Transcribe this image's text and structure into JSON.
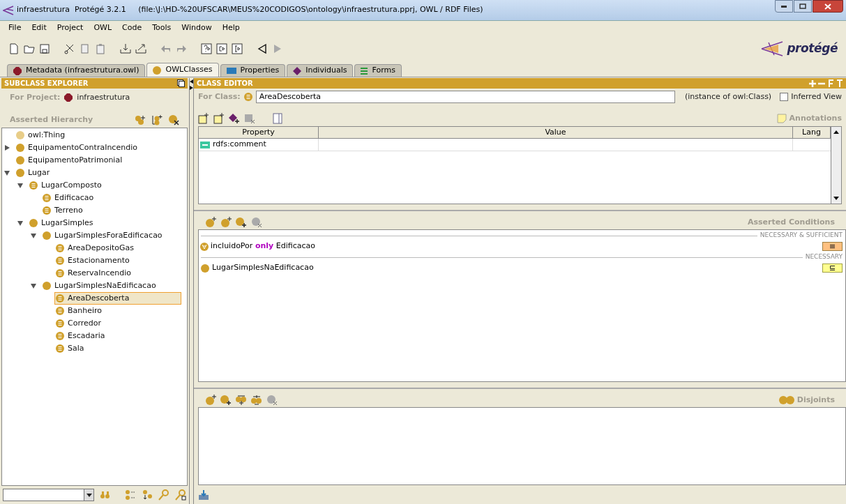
{
  "window": {
    "title": "infraestrutura  Protégé 3.2.1     (file:\\J:\\HD-%20UFSCAR\\MEUS%20CODIGOS\\ontology\\infraestrutura.pprj, OWL / RDF Files)"
  },
  "menu": [
    "File",
    "Edit",
    "Project",
    "OWL",
    "Code",
    "Tools",
    "Window",
    "Help"
  ],
  "logo": "protégé",
  "tabs": [
    {
      "label": "Metadata (infraestrutura.owl)",
      "kind": "metadata",
      "selected": false
    },
    {
      "label": "OWLClasses",
      "kind": "classes",
      "selected": true
    },
    {
      "label": "Properties",
      "kind": "properties",
      "selected": false
    },
    {
      "label": "Individuals",
      "kind": "individuals",
      "selected": false
    },
    {
      "label": "Forms",
      "kind": "forms",
      "selected": false
    }
  ],
  "subclass_explorer": {
    "title": "SUBCLASS EXPLORER",
    "for_project_label": "For Project:",
    "project": "infraestrutura",
    "hierarchy_label": "Asserted Hierarchy",
    "tree": [
      {
        "label": "owl:Thing",
        "kind": "thing",
        "selected": false
      },
      {
        "label": "EquipamentoContraIncendio",
        "kind": "primitive",
        "selected": false,
        "expanded": false
      },
      {
        "label": "EquipamentoPatrimonial",
        "kind": "primitive",
        "selected": false
      },
      {
        "label": "Lugar",
        "kind": "primitive",
        "selected": false,
        "expanded": true,
        "children": [
          {
            "label": "LugarComposto",
            "kind": "defined",
            "selected": false,
            "expanded": true,
            "children": [
              {
                "label": "Edificacao",
                "kind": "defined",
                "selected": false
              },
              {
                "label": "Terreno",
                "kind": "defined",
                "selected": false
              }
            ]
          },
          {
            "label": "LugarSimples",
            "kind": "primitive",
            "selected": false,
            "expanded": true,
            "children": [
              {
                "label": "LugarSimplesForaEdificacao",
                "kind": "primitive",
                "selected": false,
                "expanded": true,
                "children": [
                  {
                    "label": "AreaDepositoGas",
                    "kind": "defined",
                    "selected": false
                  },
                  {
                    "label": "Estacionamento",
                    "kind": "defined",
                    "selected": false
                  },
                  {
                    "label": "ReservaIncendio",
                    "kind": "defined",
                    "selected": false
                  }
                ]
              },
              {
                "label": "LugarSimplesNaEdificacao",
                "kind": "primitive",
                "selected": false,
                "expanded": true,
                "children": [
                  {
                    "label": "AreaDescoberta",
                    "kind": "defined",
                    "selected": true
                  },
                  {
                    "label": "Banheiro",
                    "kind": "defined",
                    "selected": false
                  },
                  {
                    "label": "Corredor",
                    "kind": "defined",
                    "selected": false
                  },
                  {
                    "label": "Escadaria",
                    "kind": "defined",
                    "selected": false
                  },
                  {
                    "label": "Sala",
                    "kind": "defined",
                    "selected": false
                  }
                ]
              }
            ]
          }
        ]
      }
    ]
  },
  "class_editor": {
    "title": "CLASS EDITOR",
    "for_class_label": "For Class:",
    "class_name": "AreaDescoberta",
    "instance_label": "(instance of owl:Class)",
    "inferred_view": {
      "label": "Inferred View",
      "checked": false
    },
    "annotations_label": "Annotations",
    "table": {
      "columns": [
        "Property",
        "Value",
        "Lang"
      ],
      "rows": [
        {
          "property": "rdfs:comment"
        }
      ]
    },
    "conditions_label": "Asserted Conditions",
    "conditions": [
      {
        "section": "NECESSARY & SUFFICIENT",
        "kind": "equivalent",
        "items": [
          {
            "text": "incluidoPor **only** Edificacao",
            "kind": "restriction"
          }
        ]
      },
      {
        "section": "NECESSARY",
        "kind": "subclass",
        "items": [
          {
            "text": "LugarSimplesNaEdificacao",
            "kind": "class"
          }
        ]
      }
    ],
    "disjoints_label": "Disjoints"
  }
}
